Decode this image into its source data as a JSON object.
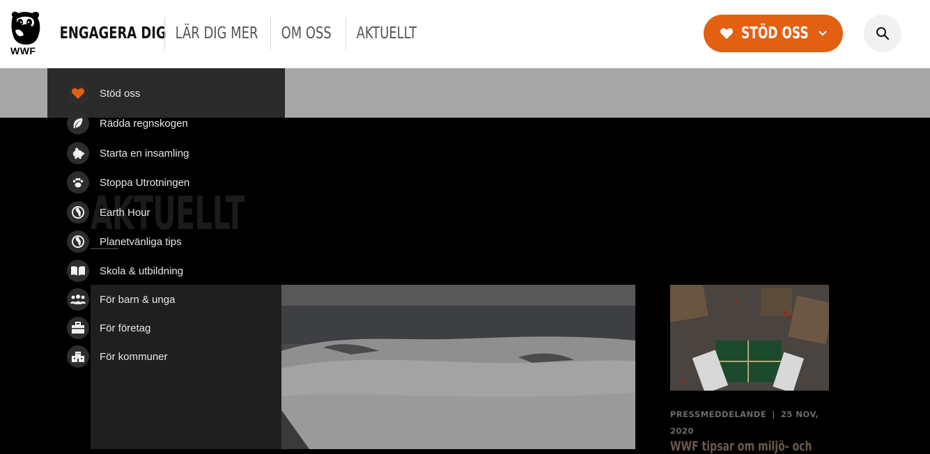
{
  "brand": {
    "logo_text": "WWF"
  },
  "nav": {
    "items": [
      "ENGAGERA DIG",
      "LÄR DIG MER",
      "OM OSS",
      "AKTUELLT"
    ],
    "active": "ENGAGERA DIG"
  },
  "donate": {
    "label": "STÖD OSS"
  },
  "menu": {
    "items": [
      {
        "label": "Stöd oss",
        "icon": "heart-icon"
      },
      {
        "label": "Rädda regnskogen",
        "icon": "leaf-icon"
      },
      {
        "label": "Starta en insamling",
        "icon": "piggy-bank-icon"
      },
      {
        "label": "Stoppa Utrotningen",
        "icon": "paw-icon"
      },
      {
        "label": "Earth Hour",
        "icon": "globe-icon"
      },
      {
        "label": "Planetvänliga tips",
        "icon": "globe-icon"
      },
      {
        "label": "Skola & utbildning",
        "icon": "book-icon"
      },
      {
        "label": "För barn & unga",
        "icon": "people-icon"
      },
      {
        "label": "För företag",
        "icon": "briefcase-icon"
      },
      {
        "label": "För kommuner",
        "icon": "building-icon"
      }
    ]
  },
  "page": {
    "title": "AKTUELLT"
  },
  "card": {
    "category": "PRESSMEDDELANDE",
    "separator": "|",
    "date": "25 NOV, 2020",
    "title": "WWF tipsar om miljö- och"
  },
  "colors": {
    "accent": "#e35f12",
    "header_bg": "#ffffff",
    "overlay_bg": "#000000",
    "menu_bg": "#2a2a2a"
  }
}
